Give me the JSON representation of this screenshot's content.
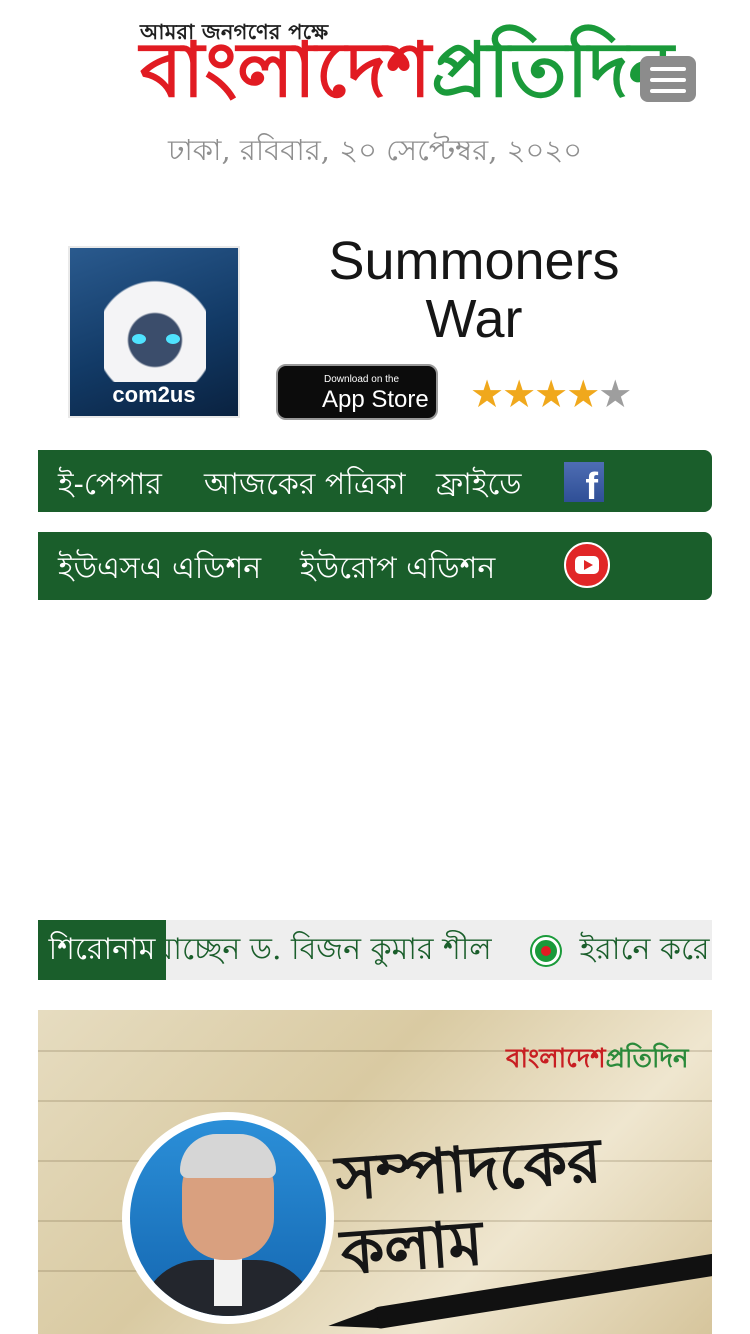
{
  "header": {
    "tagline": "আমরা জনগণের পক্ষে",
    "logo_part1": "বাংলাদেশ",
    "logo_part2": "প্রতিদিন",
    "date": "ঢাকা, রবিবার, ২০ সেপ্টেম্বর, ২০২০",
    "menu_icon": "hamburger-menu-icon"
  },
  "ad": {
    "title": "Summoners War",
    "brand": "com2us",
    "store_small": "Download on the",
    "store_big": "App Store",
    "rating": 4.5,
    "rating_max": 5
  },
  "nav": {
    "row1": [
      "ই-পেপার",
      "আজকের পত্রিকা",
      "ফ্রাইডে"
    ],
    "row2": [
      "ইউএসএ এডিশন",
      "ইউরোপ এডিশন"
    ],
    "facebook_icon": "facebook-icon",
    "youtube_icon": "youtube-icon"
  },
  "ticker": {
    "label": "শিরোনাম",
    "items": [
      "যাচ্ছেন ড. বিজন কুমার শীল",
      "ইরানে করে"
    ]
  },
  "banner": {
    "logo_part1": "বাংলাদেশ",
    "logo_part2": "প্রতিদিন",
    "title": "সম্পাদকের কলাম"
  },
  "colors": {
    "brand_red": "#e11b22",
    "brand_green": "#1a9a3a",
    "nav_green": "#1a5e2b"
  }
}
